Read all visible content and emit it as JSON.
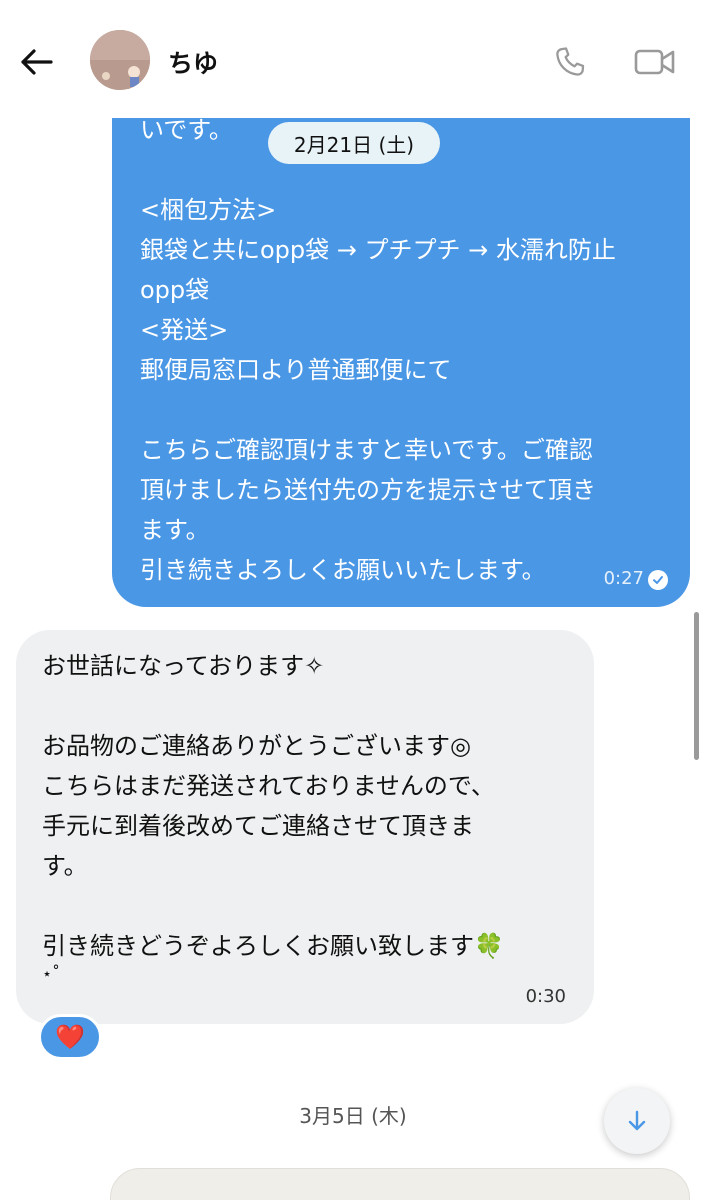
{
  "header": {
    "back_icon": "arrow-left-icon",
    "contact_name": "ちゆ",
    "call_icon": "phone-icon",
    "video_icon": "video-camera-icon"
  },
  "date_pill": "2月21日 (土)",
  "outgoing_message": {
    "lines": [
      "いです。",
      "",
      "<梱包方法>",
      "銀袋と共にopp袋 → プチプチ → 水濡れ防止",
      "opp袋",
      "<発送>",
      "郵便局窓口より普通郵便にて",
      "",
      "こちらご確認頂けますと幸いです。ご確認",
      "頂けましたら送付先の方を提示させて頂き",
      "ます。",
      "引き続きよろしくお願いいたします。"
    ],
    "time": "0:27",
    "status_icon": "read-check-icon",
    "color": "#4a97e6"
  },
  "incoming_message": {
    "lines": [
      "お世話になっております✧",
      "",
      "お品物のご連絡ありがとうございます◎",
      "こちらはまだ発送されておりませんので、",
      "手元に到着後改めてご連絡させて頂きま",
      "す。",
      "",
      "引き続きどうぞよろしくお願い致します🍀",
      "⋆˚"
    ],
    "time": "0:30",
    "reaction": "❤️",
    "color": "#eef0f1"
  },
  "date_label": "3月5日 (木)",
  "scroll_down_icon": "arrow-down-icon"
}
